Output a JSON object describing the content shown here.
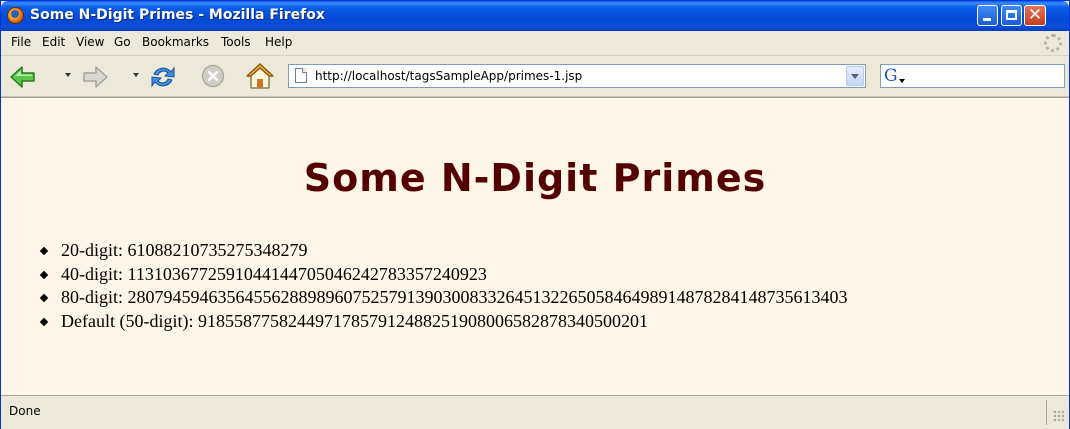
{
  "window": {
    "title": "Some N-Digit Primes - Mozilla Firefox"
  },
  "menu": {
    "items": [
      "File",
      "Edit",
      "View",
      "Go",
      "Bookmarks",
      "Tools",
      "Help"
    ]
  },
  "nav": {
    "url": "http://localhost/tagsSampleApp/primes-1.jsp",
    "icons": [
      "back-arrow",
      "forward-arrow",
      "reload",
      "stop",
      "home",
      "page",
      "google-search"
    ]
  },
  "page": {
    "title": "Some N-Digit Primes",
    "primes": [
      "20-digit: 61088210735275348279",
      "40-digit: 1131036772591044144705046242783357240923",
      "80-digit: 28079459463564556288989607525791390300833264513226505846498914878284148735613403",
      "Default (50-digit): 91855877582449717857912488251908006582878340500201"
    ]
  },
  "status": {
    "text": "Done"
  },
  "colors": {
    "page_background": "#fdf5e6",
    "heading": "#550000",
    "titlebar": "#0a5fe8"
  }
}
